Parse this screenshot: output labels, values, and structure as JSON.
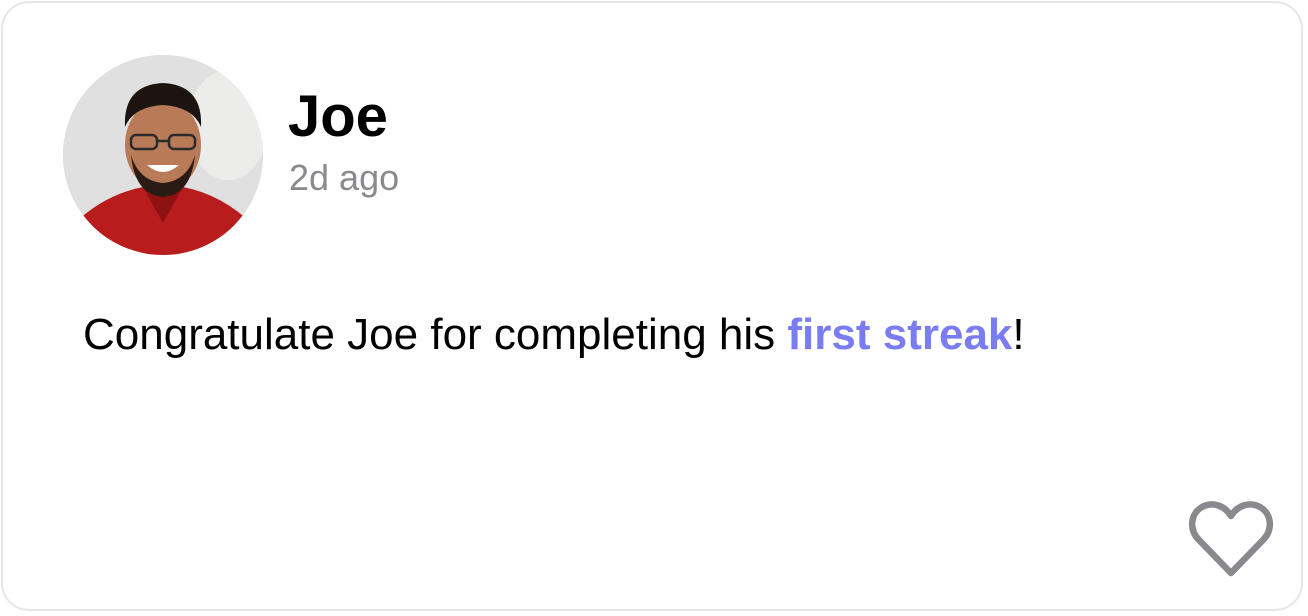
{
  "post": {
    "author_name": "Joe",
    "timestamp": "2d ago",
    "message_prefix": "Congratulate Joe for completing his ",
    "message_highlight": "first streak",
    "message_suffix": "!"
  },
  "colors": {
    "highlight": "#7a7cf2",
    "timestamp": "#8a8a8e",
    "heart_outline": "#8a8a8e",
    "card_border": "#e6e6e6"
  },
  "icons": {
    "like": "heart-outline-icon"
  }
}
